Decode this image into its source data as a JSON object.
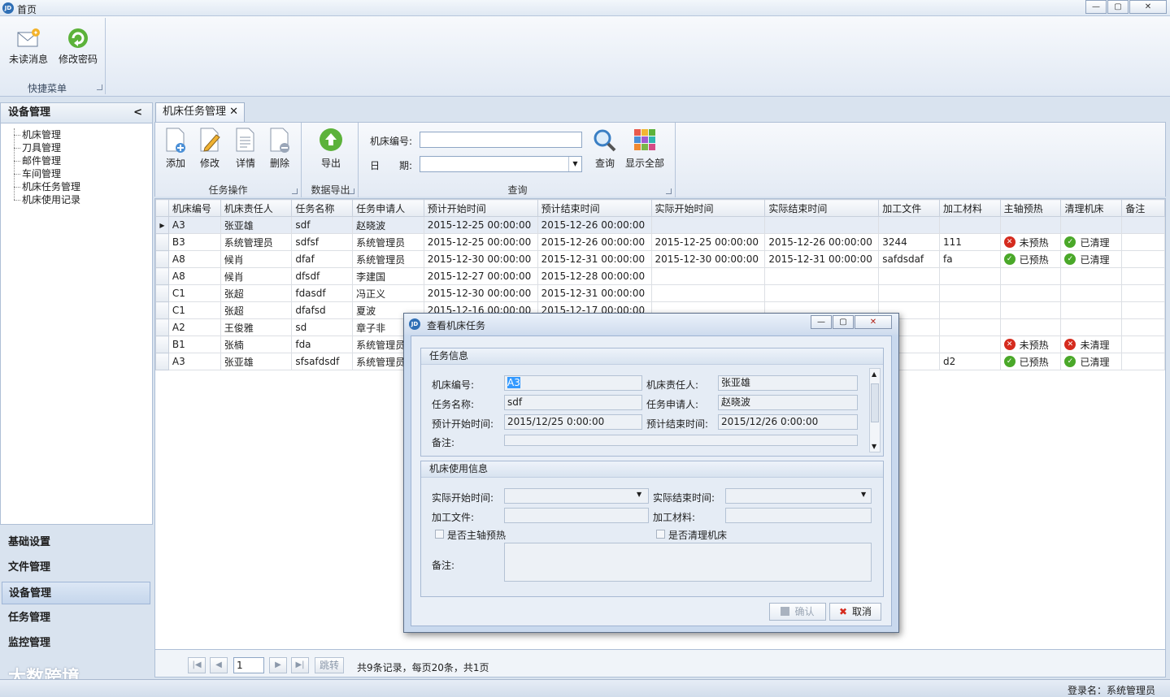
{
  "window": {
    "title": "首页",
    "logo": "JD",
    "minimize": "—",
    "maximize": "▢",
    "close": "✕"
  },
  "ribbon": {
    "unread": "未读消息",
    "change_password": "修改密码",
    "group_label": "快捷菜单"
  },
  "left": {
    "header": "设备管理",
    "collapse": "<",
    "tree": [
      "机床管理",
      "刀具管理",
      "邮件管理",
      "车间管理",
      "机床任务管理",
      "机床使用记录"
    ],
    "nav": [
      "基础设置",
      "文件管理",
      "设备管理",
      "任务管理",
      "监控管理"
    ],
    "watermark": "大数跨境"
  },
  "tab": {
    "label": "机床任务管理",
    "close": "✕"
  },
  "toolbar": {
    "add": "添加",
    "edit": "修改",
    "detail": "详情",
    "delete": "删除",
    "group_task": "任务操作",
    "export": "导出",
    "group_export": "数据导出",
    "machine_no_label": "机床编号:",
    "date_label": "日　　期:",
    "query": "查询",
    "show_all": "显示全部",
    "group_query": "查询"
  },
  "grid": {
    "columns": [
      "机床编号",
      "机床责任人",
      "任务名称",
      "任务申请人",
      "预计开始时间",
      "预计结束时间",
      "实际开始时间",
      "实际结束时间",
      "加工文件",
      "加工材料",
      "主轴预热",
      "清理机床",
      "备注"
    ],
    "rows": [
      {
        "no": "A3",
        "owner": "张亚雄",
        "task": "sdf",
        "applicant": "赵晓波",
        "pstart": "2015-12-25 00:00:00",
        "pend": "2015-12-26 00:00:00",
        "astart": "",
        "aend": "",
        "file": "",
        "material": "",
        "preheat": "",
        "clean": "",
        "note": ""
      },
      {
        "no": "B3",
        "owner": "系统管理员",
        "task": "sdfsf",
        "applicant": "系统管理员",
        "pstart": "2015-12-25 00:00:00",
        "pend": "2015-12-26 00:00:00",
        "astart": "2015-12-25 00:00:00",
        "aend": "2015-12-26 00:00:00",
        "file": "3244",
        "material": "111",
        "preheat": "未预热",
        "clean": "已清理",
        "note": ""
      },
      {
        "no": "A8",
        "owner": "候肖",
        "task": "dfaf",
        "applicant": "系统管理员",
        "pstart": "2015-12-30 00:00:00",
        "pend": "2015-12-31 00:00:00",
        "astart": "2015-12-30 00:00:00",
        "aend": "2015-12-31 00:00:00",
        "file": "safdsdaf",
        "material": "fa",
        "preheat": "已预热",
        "clean": "已清理",
        "note": ""
      },
      {
        "no": "A8",
        "owner": "候肖",
        "task": "dfsdf",
        "applicant": "李建国",
        "pstart": "2015-12-27 00:00:00",
        "pend": "2015-12-28 00:00:00",
        "astart": "",
        "aend": "",
        "file": "",
        "material": "",
        "preheat": "",
        "clean": "",
        "note": ""
      },
      {
        "no": "C1",
        "owner": "张超",
        "task": "fdasdf",
        "applicant": "冯正义",
        "pstart": "2015-12-30 00:00:00",
        "pend": "2015-12-31 00:00:00",
        "astart": "",
        "aend": "",
        "file": "",
        "material": "",
        "preheat": "",
        "clean": "",
        "note": ""
      },
      {
        "no": "C1",
        "owner": "张超",
        "task": "dfafsd",
        "applicant": "夏波",
        "pstart": "2015-12-16 00:00:00",
        "pend": "2015-12-17 00:00:00",
        "astart": "",
        "aend": "",
        "file": "",
        "material": "",
        "preheat": "",
        "clean": "",
        "note": ""
      },
      {
        "no": "A2",
        "owner": "王俊雅",
        "task": "sd",
        "applicant": "章子非",
        "pstart": "",
        "pend": "",
        "astart": "",
        "aend": "",
        "file": "",
        "material": "",
        "preheat": "",
        "clean": "",
        "note": ""
      },
      {
        "no": "B1",
        "owner": "张楠",
        "task": "fda",
        "applicant": "系统管理员",
        "pstart": "",
        "pend": "",
        "astart": "",
        "aend": "",
        "file": "",
        "material": "",
        "preheat": "未预热",
        "clean": "未清理",
        "note": ""
      },
      {
        "no": "A3",
        "owner": "张亚雄",
        "task": "sfsafdsdf",
        "applicant": "系统管理员",
        "pstart": "",
        "pend": "",
        "astart": "",
        "aend": "",
        "file": "",
        "material": "d2",
        "preheat": "已预热",
        "clean": "已清理",
        "note": ""
      }
    ],
    "selected_marker": "▶"
  },
  "pager": {
    "page_value": "1",
    "jump": "跳转",
    "summary": "共9条记录，每页20条，共1页"
  },
  "status": {
    "login": "登录名：系统管理员"
  },
  "dialog": {
    "title": "查看机床任务",
    "task_section": "任务信息",
    "labels": {
      "machine_no": "机床编号:",
      "owner": "机床责任人:",
      "task_name": "任务名称:",
      "applicant": "任务申请人:",
      "plan_start": "预计开始时间:",
      "plan_end": "预计结束时间:",
      "note": "备注:"
    },
    "values": {
      "machine_no": "A3",
      "owner": "张亚雄",
      "task_name": "sdf",
      "applicant": "赵晓波",
      "plan_start": "2015/12/25 0:00:00",
      "plan_end": "2015/12/26 0:00:00",
      "note": ""
    },
    "usage_section": "机床使用信息",
    "usage_labels": {
      "actual_start": "实际开始时间:",
      "actual_end": "实际结束时间:",
      "file": "加工文件:",
      "material": "加工材料:",
      "preheat": "是否主轴预热",
      "clean": "是否清理机床",
      "note": "备注:"
    },
    "usage_values": {
      "actual_start": "",
      "actual_end": "",
      "file": "",
      "material": "",
      "note": ""
    },
    "confirm": "确认",
    "cancel": "取消"
  },
  "colors": {
    "accent": "#2f6fb5",
    "red": "#d52b1e",
    "green": "#4aa829"
  }
}
